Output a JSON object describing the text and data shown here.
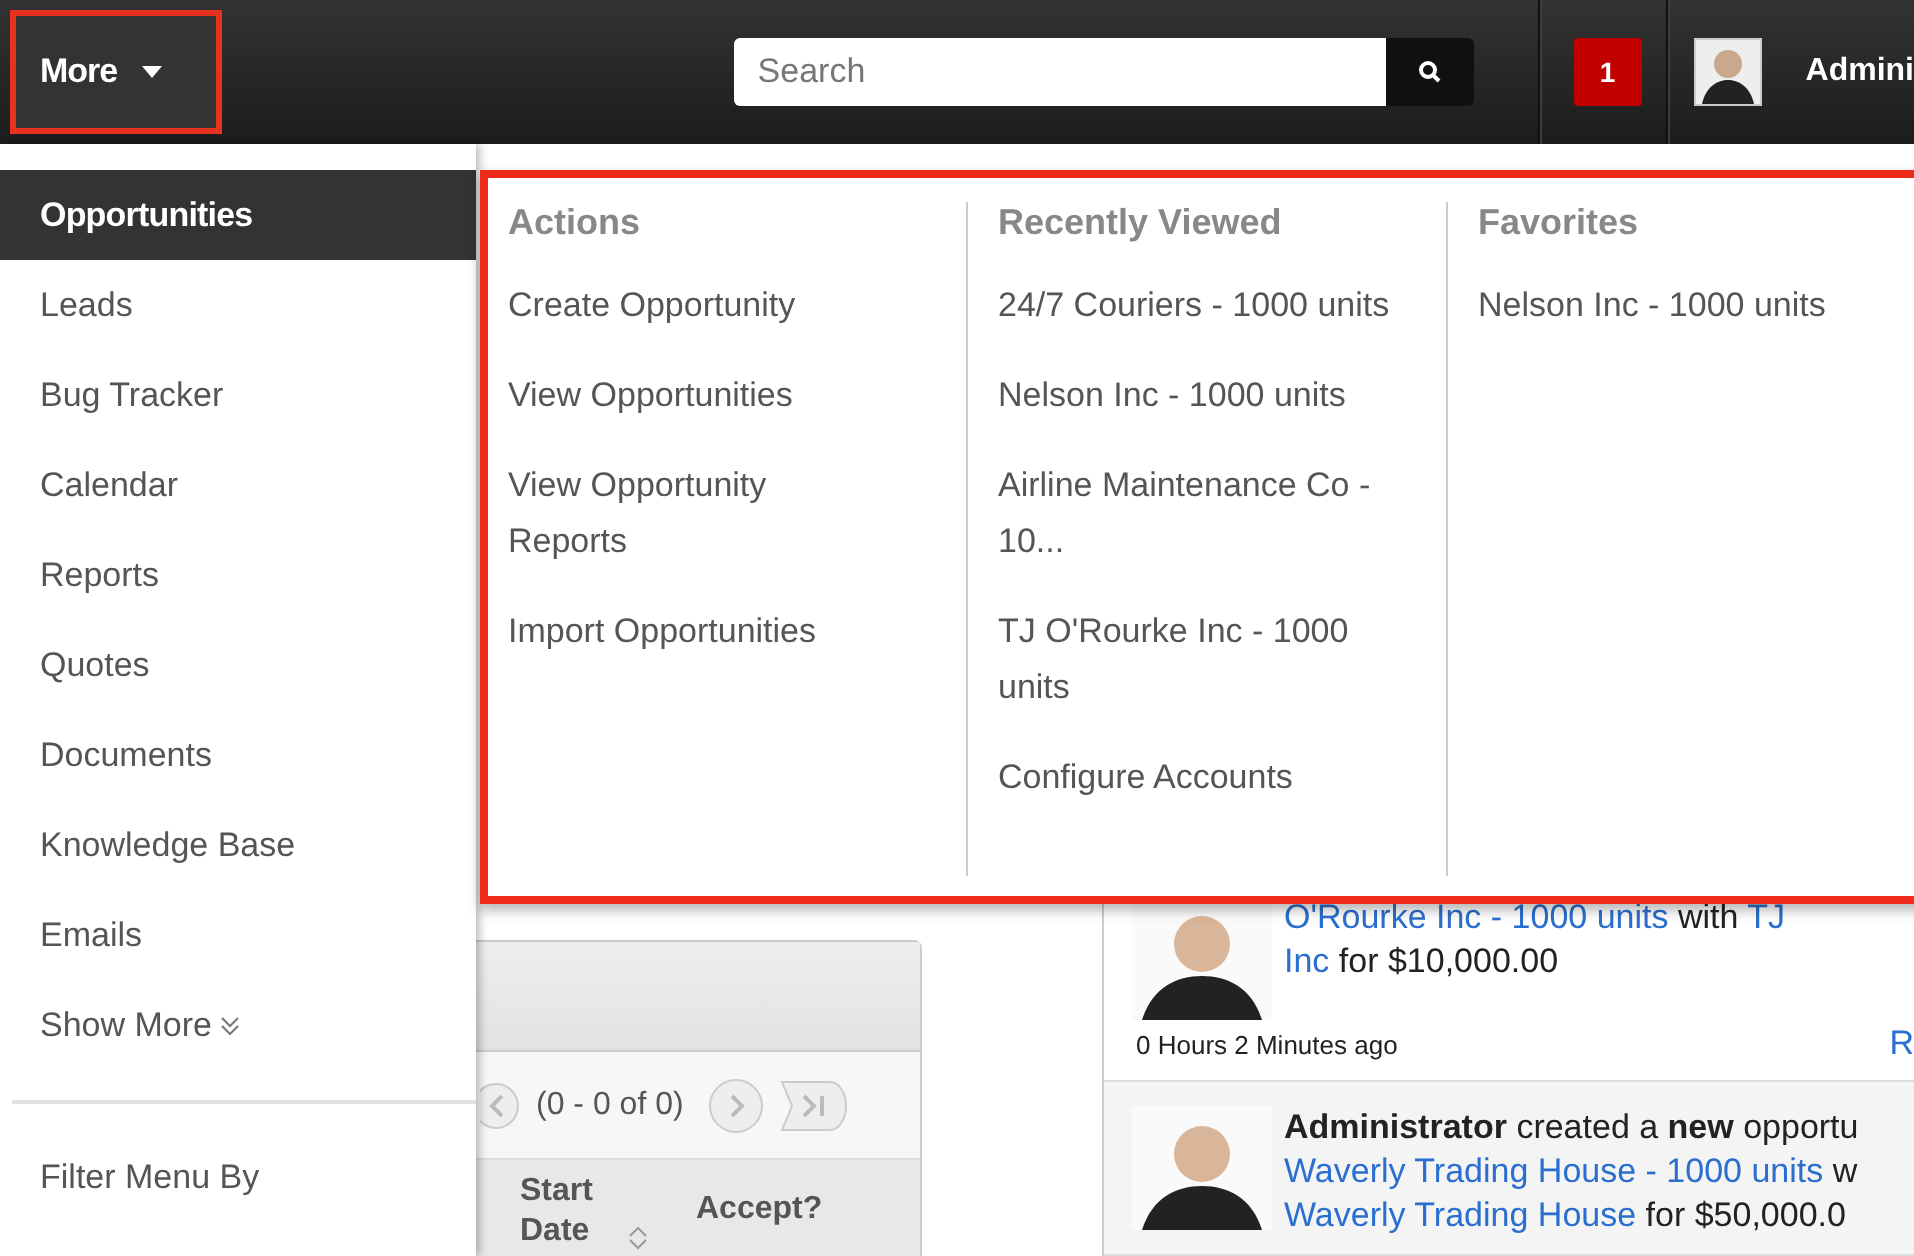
{
  "header": {
    "more_button": "More",
    "search": {
      "placeholder": "Search"
    },
    "notification_count": "1",
    "user_name": "Admini"
  },
  "menu": {
    "items": [
      {
        "label": "Opportunities",
        "selected": true
      },
      {
        "label": "Leads",
        "selected": false
      },
      {
        "label": "Bug Tracker",
        "selected": false
      },
      {
        "label": "Calendar",
        "selected": false
      },
      {
        "label": "Reports",
        "selected": false
      },
      {
        "label": "Quotes",
        "selected": false
      },
      {
        "label": "Documents",
        "selected": false
      },
      {
        "label": "Knowledge Base",
        "selected": false
      },
      {
        "label": "Emails",
        "selected": false
      }
    ],
    "show_more": "Show More",
    "filter": "Filter Menu By"
  },
  "panel": {
    "columns": [
      {
        "title": "Actions",
        "items": [
          "Create Opportunity",
          "View Opportunities",
          "View Opportunity Reports",
          "Import Opportunities"
        ]
      },
      {
        "title": "Recently Viewed",
        "items": [
          "24/7 Couriers - 1000 units",
          "Nelson Inc - 1000 units",
          "Airline Maintenance Co - 10...",
          "TJ O'Rourke Inc - 1000 units",
          "Configure Accounts"
        ]
      },
      {
        "title": "Favorites",
        "items": [
          "Nelson Inc - 1000 units"
        ]
      }
    ]
  },
  "dashlet": {
    "pagination": "(0 - 0 of 0)",
    "columns": [
      "Start Date",
      "Accept?"
    ]
  },
  "activity": [
    {
      "lines": [
        [
          {
            "kind": "link",
            "text": "O'Rourke Inc - 1000 units"
          },
          {
            "kind": "plain",
            "text": " with "
          },
          {
            "kind": "link",
            "text": "TJ"
          }
        ],
        [
          {
            "kind": "link",
            "text": "Inc"
          },
          {
            "kind": "plain",
            "text": " for $10,000.00"
          }
        ]
      ],
      "time": "0 Hours 2 Minutes ago",
      "action": "R"
    },
    {
      "lines": [
        [
          {
            "kind": "bold",
            "text": "Administrator"
          },
          {
            "kind": "plain",
            "text": " created a "
          },
          {
            "kind": "bold",
            "text": "new"
          },
          {
            "kind": "plain",
            "text": " opportu"
          }
        ],
        [
          {
            "kind": "link",
            "text": "Waverly Trading House - 1000 units"
          },
          {
            "kind": "plain",
            "text": " w"
          }
        ],
        [
          {
            "kind": "link",
            "text": "Waverly Trading House"
          },
          {
            "kind": "plain",
            "text": " for $50,000.0"
          }
        ]
      ]
    }
  ]
}
